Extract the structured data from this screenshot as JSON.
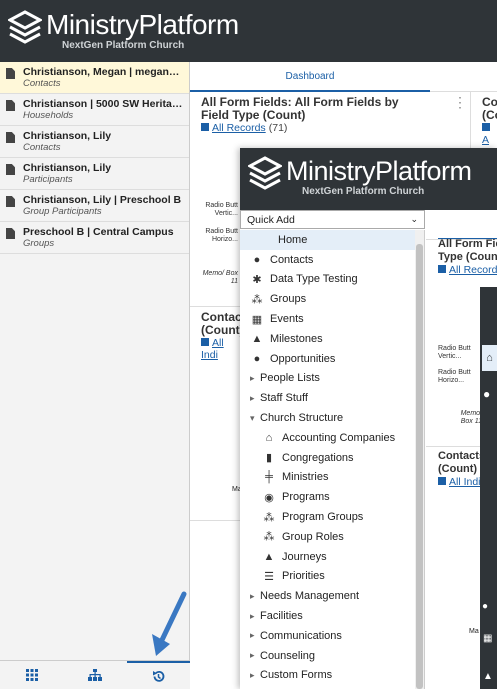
{
  "app": {
    "logo_title": "MinistryPlatform",
    "logo_subtitle": "NextGen Platform Church"
  },
  "history": [
    {
      "title": "Christianson, Megan | megan@...",
      "subtitle": "Contacts"
    },
    {
      "title": "Christianson | 5000 SW Heritage...",
      "subtitle": "Households"
    },
    {
      "title": "Christianson, Lily",
      "subtitle": "Contacts"
    },
    {
      "title": "Christianson, Lily",
      "subtitle": "Participants"
    },
    {
      "title": "Christianson, Lily | Preschool B",
      "subtitle": "Group Participants"
    },
    {
      "title": "Preschool B | Central Campus",
      "subtitle": "Groups"
    }
  ],
  "tabs": {
    "dashboard": "Dashboard"
  },
  "cards": {
    "form_fields": {
      "title": "All Form Fields: All Form Fields by Field Type (Count)",
      "link": "All Records",
      "count": "(71)",
      "ylabels": [
        "Radio Butt Vertic...",
        "Radio Butt Horizo...",
        "Memo/ Box 11"
      ]
    },
    "partial_title": "Co (Co",
    "partial_link": "A",
    "contacts": {
      "title": "Contact (Count)",
      "link": "All Indi",
      "tick": "Ma"
    }
  },
  "overlay2": {
    "quick_add": "Quick Add",
    "card_title": "All Form Fie Type (Coun",
    "card_link": "All Records",
    "ylabels": [
      "Radio Butt Vertic...",
      "Radio Butt Horizo...",
      "Memo/ Box 11"
    ],
    "contacts_title": "Contacts (Count)",
    "contacts_link": "All Indi",
    "contacts_tick": "Ma"
  },
  "menu": [
    {
      "label": "Home",
      "icon": "home-icon",
      "indent": 0,
      "hl": true
    },
    {
      "label": "Contacts",
      "icon": "person-icon",
      "indent": 0
    },
    {
      "label": "Data Type Testing",
      "icon": "gear-icon",
      "indent": 0
    },
    {
      "label": "Groups",
      "icon": "group-icon",
      "indent": 0
    },
    {
      "label": "Events",
      "icon": "calendar-icon",
      "indent": 0
    },
    {
      "label": "Milestones",
      "icon": "graduation-cap-icon",
      "indent": 0
    },
    {
      "label": "Opportunities",
      "icon": "lightbulb-icon",
      "indent": 0
    },
    {
      "label": "People Lists",
      "icon": "caret-right-icon",
      "indent": 0,
      "folder": true
    },
    {
      "label": "Staff Stuff",
      "icon": "caret-right-icon",
      "indent": 0,
      "folder": true
    },
    {
      "label": "Church Structure",
      "icon": "caret-down-icon",
      "indent": 0,
      "folder": true
    },
    {
      "label": "Accounting Companies",
      "icon": "bank-icon",
      "indent": 1
    },
    {
      "label": "Congregations",
      "icon": "building-icon",
      "indent": 1
    },
    {
      "label": "Ministries",
      "icon": "signpost-icon",
      "indent": 1
    },
    {
      "label": "Programs",
      "icon": "compass-icon",
      "indent": 1
    },
    {
      "label": "Program Groups",
      "icon": "group-icon",
      "indent": 1
    },
    {
      "label": "Group Roles",
      "icon": "group-icon",
      "indent": 1
    },
    {
      "label": "Journeys",
      "icon": "graduation-cap-icon",
      "indent": 1
    },
    {
      "label": "Priorities",
      "icon": "list-icon",
      "indent": 1
    },
    {
      "label": "Needs Management",
      "icon": "caret-right-icon",
      "indent": 0,
      "folder": true
    },
    {
      "label": "Facilities",
      "icon": "caret-right-icon",
      "indent": 0,
      "folder": true
    },
    {
      "label": "Communications",
      "icon": "caret-right-icon",
      "indent": 0,
      "folder": true
    },
    {
      "label": "Counseling",
      "icon": "caret-right-icon",
      "indent": 0,
      "folder": true
    },
    {
      "label": "Custom Forms",
      "icon": "caret-right-icon",
      "indent": 0,
      "folder": true
    }
  ],
  "colors": {
    "header": "#2f3438",
    "accent": "#1b5fa6",
    "arrow": "#3a78c2"
  }
}
